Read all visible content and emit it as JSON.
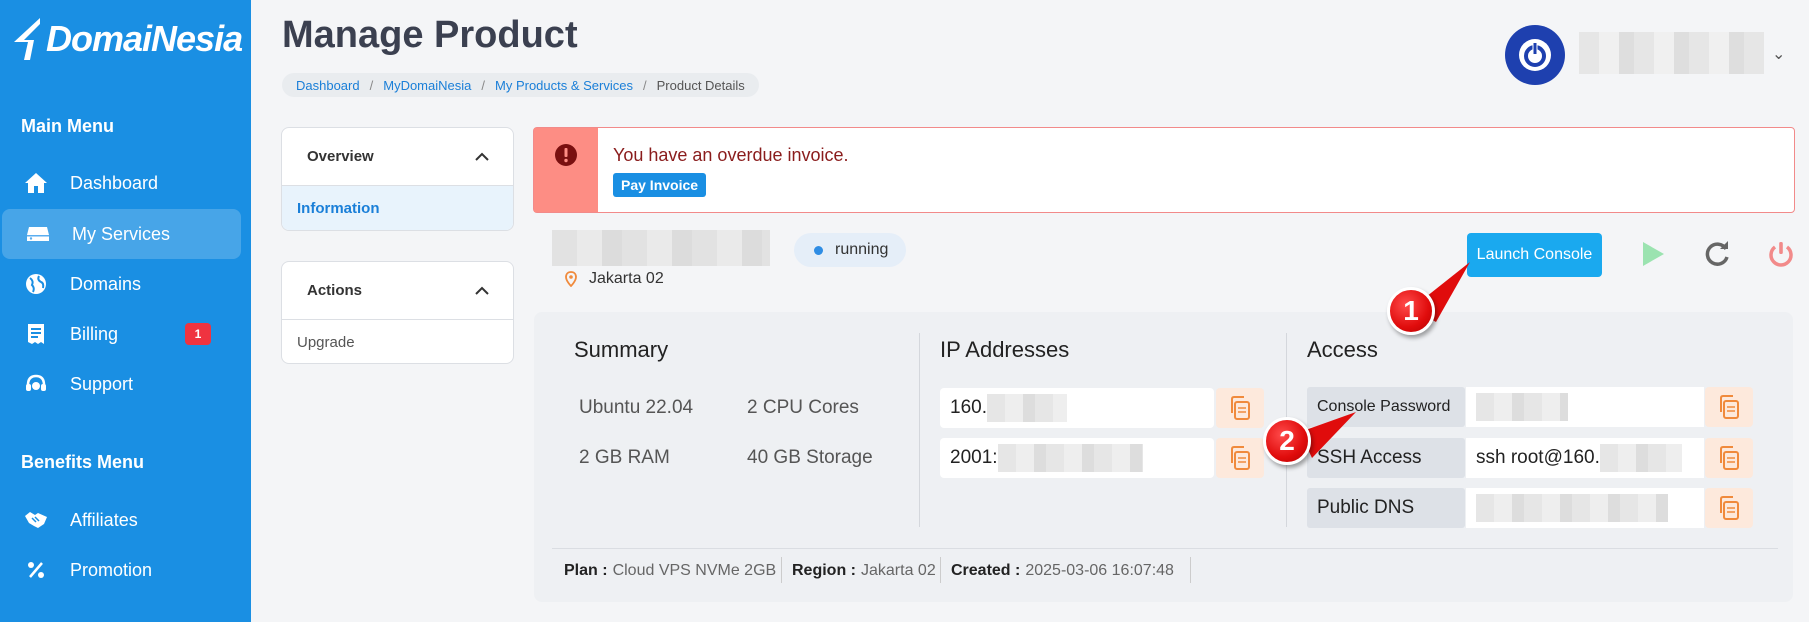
{
  "brand": {
    "name": "DomaiNesia"
  },
  "sidebar": {
    "main_heading": "Main Menu",
    "items": [
      {
        "label": "Dashboard",
        "icon": "home-icon"
      },
      {
        "label": "My Services",
        "icon": "server-icon",
        "active": true
      },
      {
        "label": "Domains",
        "icon": "globe-icon"
      },
      {
        "label": "Billing",
        "icon": "receipt-icon",
        "badge": "1"
      },
      {
        "label": "Support",
        "icon": "headset-icon"
      }
    ],
    "benefits_heading": "Benefits Menu",
    "benefits": [
      {
        "label": "Affiliates",
        "icon": "handshake-icon"
      },
      {
        "label": "Promotion",
        "icon": "percent-icon"
      }
    ]
  },
  "header": {
    "title": "Manage Product",
    "breadcrumb": [
      "Dashboard",
      "MyDomaiNesia",
      "My Products & Services",
      "Product Details"
    ]
  },
  "left_panels": {
    "overview": {
      "title": "Overview",
      "items": [
        "Information"
      ]
    },
    "actions": {
      "title": "Actions",
      "items": [
        "Upgrade"
      ]
    }
  },
  "alert": {
    "message": "You have an overdue invoice.",
    "button": "Pay Invoice"
  },
  "server": {
    "location": "Jakarta 02",
    "status": "running",
    "launch_console": "Launch Console"
  },
  "summary": {
    "title": "Summary",
    "os": "Ubuntu 22.04",
    "cpu": "2 CPU Cores",
    "ram": "2 GB RAM",
    "storage": "40 GB Storage"
  },
  "ip": {
    "title": "IP Addresses",
    "ipv4_prefix": "160.",
    "ipv6_prefix": "2001:"
  },
  "access": {
    "title": "Access",
    "console_password_label": "Console Password",
    "ssh_label": "SSH Access",
    "ssh_value": "ssh root@160.",
    "dns_label": "Public DNS"
  },
  "meta": {
    "plan_label": "Plan :",
    "plan_value": "Cloud VPS NVMe 2GB",
    "region_label": "Region :",
    "region_value": "Jakarta 02",
    "created_label": "Created :",
    "created_value": "2025-03-06 16:07:48"
  },
  "callouts": [
    "1",
    "2"
  ],
  "colors": {
    "sidebar": "#1a8fe3",
    "accent": "#1aa9ef",
    "alert": "#fd8d84",
    "copy": "#f08a3c"
  }
}
